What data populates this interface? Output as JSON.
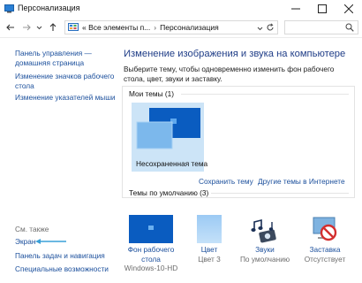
{
  "window": {
    "title": "Персонализация"
  },
  "navigation": {
    "breadcrumb_1": "« Все элементы п...",
    "separator": "›",
    "breadcrumb_2": "Персонализация"
  },
  "sidebar": {
    "items": [
      {
        "label_line1": "Панель управления —",
        "label_line2": "домашняя страница"
      },
      {
        "label_line1": "Изменение значков рабочего",
        "label_line2": "стола"
      },
      {
        "label_line1": "Изменение указателей мыши",
        "label_line2": ""
      }
    ],
    "see_also_title": "См. также",
    "see_also_items": [
      "Экран",
      "Панель задач и навигация",
      "Специальные возможности"
    ]
  },
  "main": {
    "title": "Изменение изображения и звука на компьютере",
    "description": "Выберите тему, чтобы одновременно изменить фон рабочего стола, цвет, звуки и заставку."
  },
  "themes": {
    "my_themes_title": "Мои темы (1)",
    "unsaved_theme_label": "Несохраненная тема",
    "save_link": "Сохранить тему",
    "online_link": "Другие темы в Интернете",
    "default_themes_title": "Темы по умолчанию (3)"
  },
  "bottom": {
    "items": [
      {
        "label_line1": "Фон рабочего",
        "label_line2": "стола",
        "value": "Windows-10-HD"
      },
      {
        "label_line1": "Цвет",
        "label_line2": "",
        "value": "Цвет 3"
      },
      {
        "label_line1": "Звуки",
        "label_line2": "",
        "value": "По умолчанию"
      },
      {
        "label_line1": "Заставка",
        "label_line2": "",
        "value": "Отсутствует"
      }
    ]
  },
  "colors": {
    "link": "#1b4f9c",
    "title": "#1f3d87",
    "windows_blue": "#0a5cc0",
    "selection": "#cce4f7",
    "annotation_arrow": "#3aa0d8"
  },
  "icons": {
    "back": "arrow-left-icon",
    "forward": "arrow-right-icon",
    "up": "arrow-up-icon",
    "location": "control-panel-icon",
    "search": "search-icon",
    "sounds": "music-notes-icon",
    "screensaver": "no-sign-icon"
  }
}
